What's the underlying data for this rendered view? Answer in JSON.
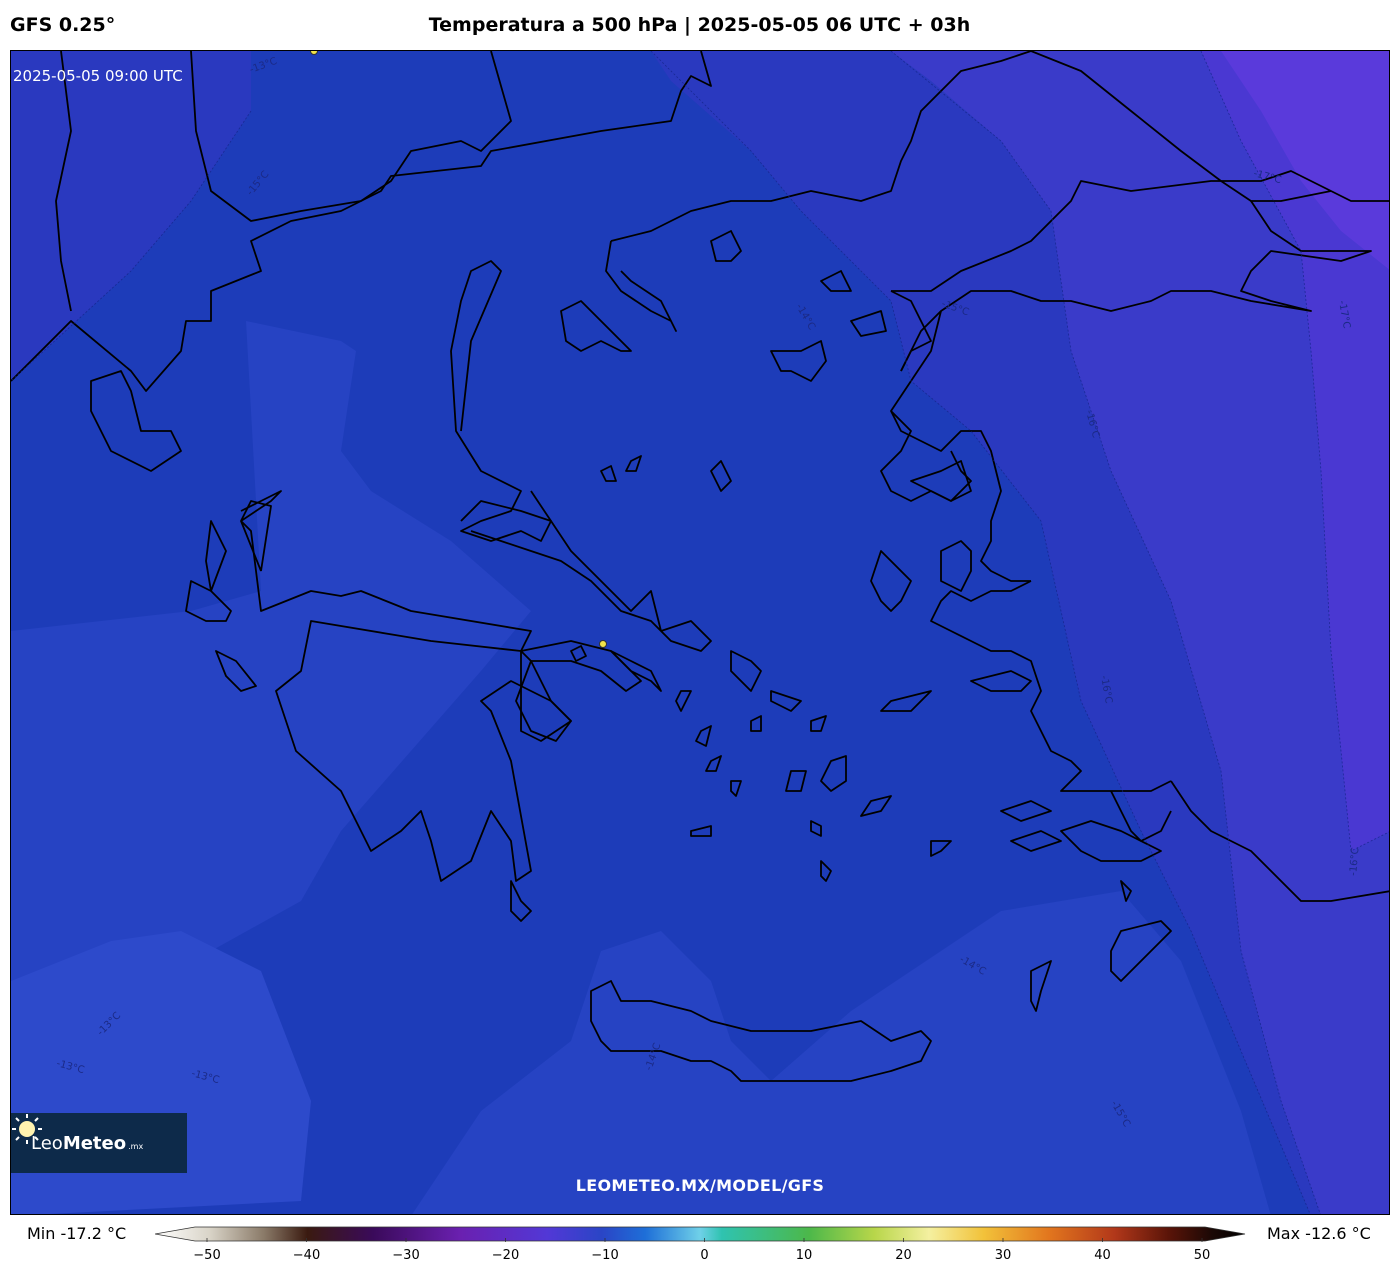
{
  "header": {
    "model": "GFS 0.25°",
    "title": "Temperatura a 500 hPa | 2025-05-05 06 UTC + 03h"
  },
  "map": {
    "valid_time": "2025-05-05 09:00 UTC",
    "watermark": "LEOMETEO.MX/MODEL/GFS",
    "logo": {
      "word_light": "Leo",
      "word_bold": "Meteo",
      "tld": ".mx"
    },
    "contour_labels": [
      "-13°C",
      "-15°C",
      "-14°C",
      "-15°C",
      "-17°C",
      "-17°C",
      "-16°C",
      "-16°C",
      "-16°C",
      "-13°C",
      "-13°C",
      "-13°C",
      "-14°C",
      "-14°C",
      "-15°C"
    ],
    "fill_colors": {
      "t_minus13": "#2a48c8",
      "t_minus14": "#1d3cb9",
      "t_minus15": "#2a39bf",
      "t_minus16": "#3a3bc9",
      "t_minus17": "#5239d6",
      "coast": "#000000"
    }
  },
  "colorbar": {
    "min_label": "Min -17.2 °C",
    "max_label": "Max -12.6 °C",
    "ticks": [
      "−50",
      "−40",
      "−30",
      "−20",
      "−10",
      "0",
      "10",
      "20",
      "30",
      "40",
      "50"
    ],
    "range": [
      -50,
      50
    ]
  }
}
